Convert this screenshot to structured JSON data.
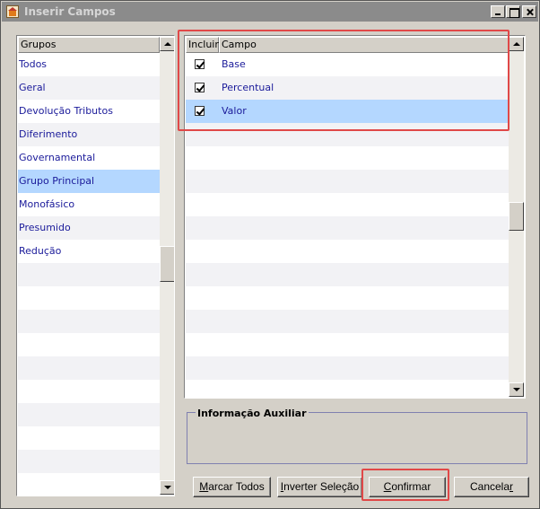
{
  "window": {
    "title": "Inserir Campos"
  },
  "groups_panel": {
    "header": "Grupos",
    "items": [
      {
        "label": "Todos"
      },
      {
        "label": "Geral"
      },
      {
        "label": "Devolução Tributos"
      },
      {
        "label": "Diferimento"
      },
      {
        "label": "Governamental"
      },
      {
        "label": "Grupo Principal"
      },
      {
        "label": "Monofásico"
      },
      {
        "label": "Presumido"
      },
      {
        "label": "Redução"
      }
    ],
    "selected": "Grupo Principal"
  },
  "fields_panel": {
    "header_include": "Incluir",
    "header_field": "Campo",
    "rows": [
      {
        "label": "Base",
        "checked": true
      },
      {
        "label": "Percentual",
        "checked": true
      },
      {
        "label": "Valor",
        "checked": true
      }
    ],
    "selected": "Valor"
  },
  "aux_info": {
    "title": "Informação Auxiliar"
  },
  "buttons": {
    "mark_all_prefix": "",
    "mark_all_key": "M",
    "mark_all_rest": "arcar Todos",
    "invert_prefix": "",
    "invert_key": "I",
    "invert_rest": "nverter Seleção",
    "confirm_prefix": "",
    "confirm_key": "C",
    "confirm_rest": "onfirmar",
    "cancel_prefix": "Cancela",
    "cancel_key": "r",
    "cancel_rest": ""
  },
  "colors": {
    "highlight": "#e04848",
    "selection": "#b4d7ff",
    "item_text": "#1a1a9a"
  }
}
